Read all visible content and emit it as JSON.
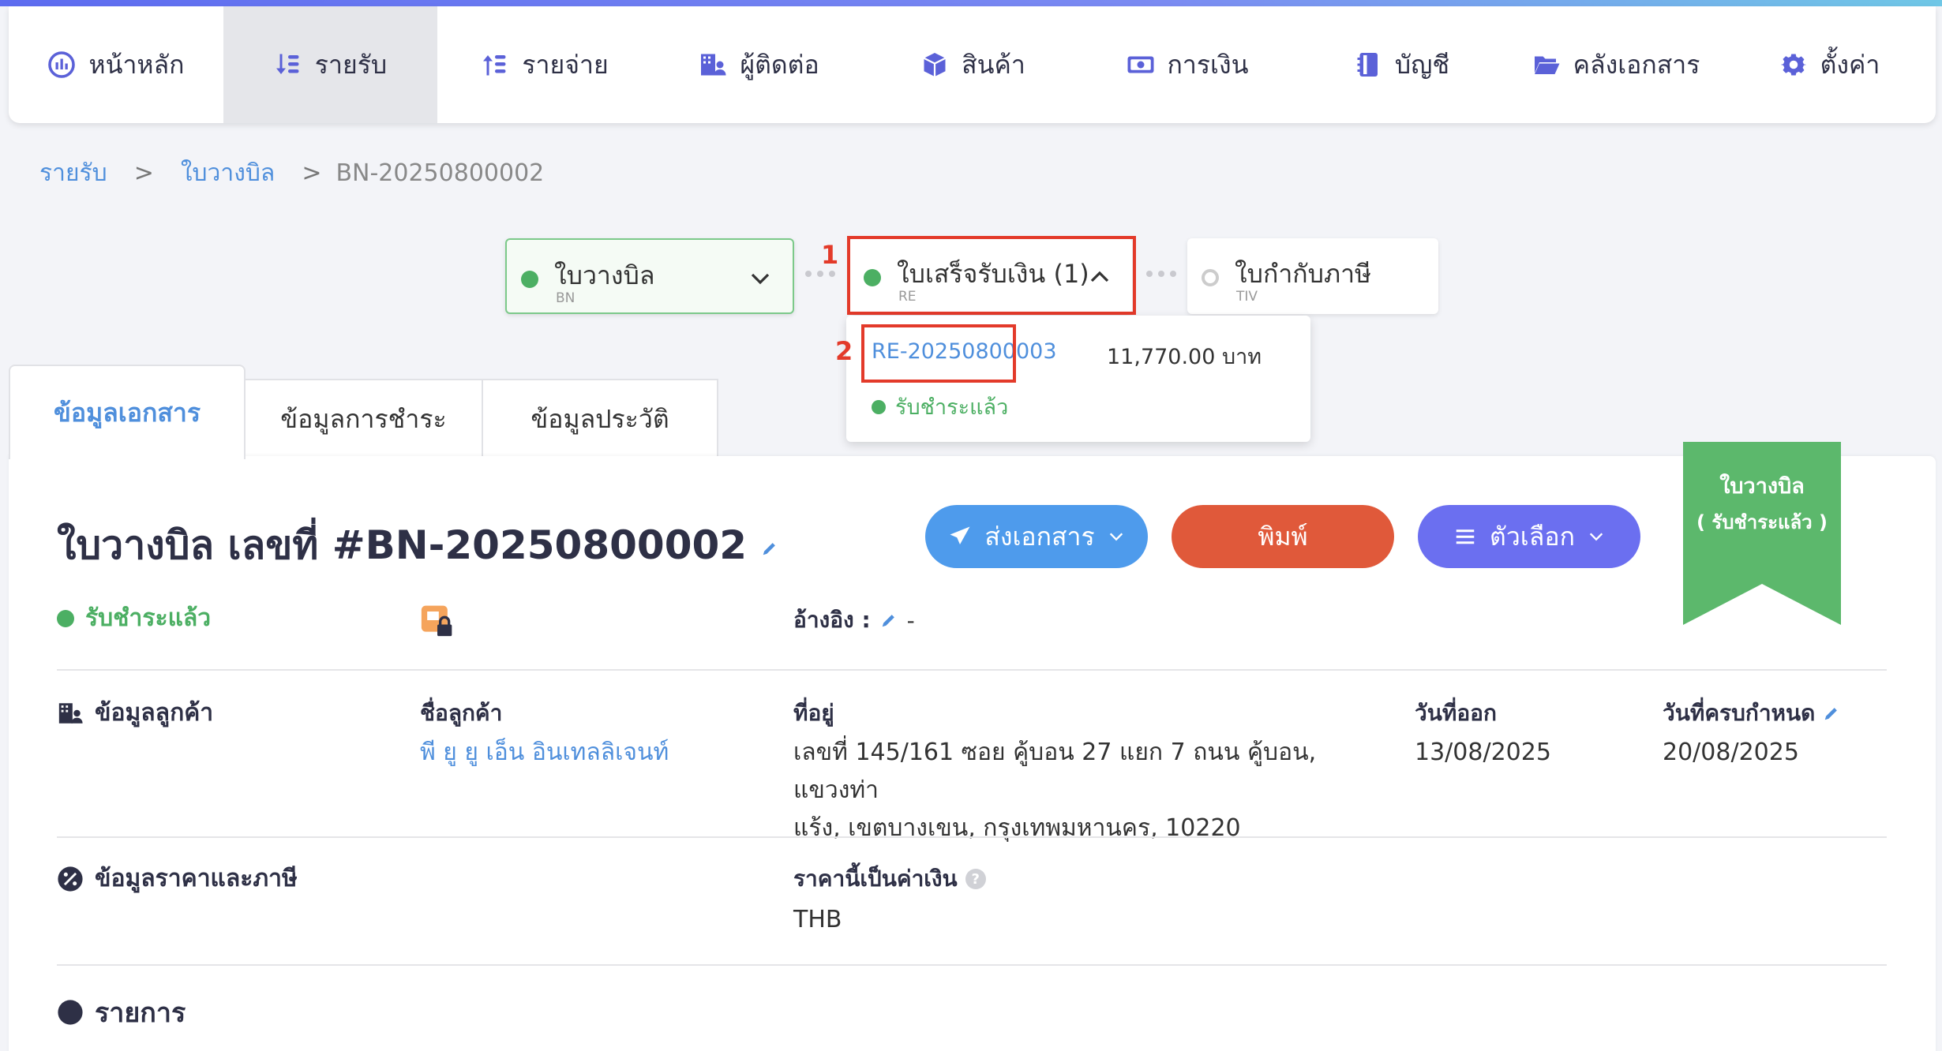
{
  "nav": {
    "items": [
      {
        "label": "หน้าหลัก",
        "icon": "dashboard-icon"
      },
      {
        "label": "รายรับ",
        "icon": "income-icon",
        "active": true
      },
      {
        "label": "รายจ่าย",
        "icon": "expense-icon"
      },
      {
        "label": "ผู้ติดต่อ",
        "icon": "contacts-icon"
      },
      {
        "label": "สินค้า",
        "icon": "product-box-icon"
      },
      {
        "label": "การเงิน",
        "icon": "money-icon"
      },
      {
        "label": "บัญชี",
        "icon": "ledger-book-icon"
      },
      {
        "label": "คลังเอกสาร",
        "icon": "folder-icon"
      },
      {
        "label": "ตั้งค่า",
        "icon": "gear-icon"
      }
    ]
  },
  "breadcrumb": {
    "level1": "รายรับ",
    "level2": "ใบวางบิล",
    "current": "BN-20250800002",
    "sep": ">"
  },
  "flow": {
    "step1": {
      "title": "ใบวางบิล",
      "sub": "BN"
    },
    "step2": {
      "title": "ใบเสร็จรับเงิน (1)",
      "sub": "RE"
    },
    "step3": {
      "title": "ใบกำกับภาษี",
      "sub": "TIV"
    },
    "annotation1": "1",
    "annotation2": "2"
  },
  "dropdown": {
    "doc_no": "RE-20250800003",
    "amount": "11,770.00 บาท",
    "status": "รับชำระแล้ว"
  },
  "tabs": [
    "ข้อมูลเอกสาร",
    "ข้อมูลการชำระ",
    "ข้อมูลประวัติ"
  ],
  "document": {
    "title": "ใบวางบิล เลขที่ #BN-20250800002",
    "status": "รับชำระแล้ว",
    "ref_label": "อ้างอิง :",
    "ref_value": "-"
  },
  "actions": {
    "send": "ส่งเอกสาร",
    "print": "พิมพ์",
    "options": "ตัวเลือก"
  },
  "ribbon": {
    "line1": "ใบวางบิล",
    "line2": "( รับชำระแล้ว )"
  },
  "customer": {
    "section_title": "ข้อมูลลูกค้า",
    "name_label": "ชื่อลูกค้า",
    "name_value": "พี ยู ยู เอ็น อินเทลลิเจนท์",
    "address_label": "ที่อยู่",
    "address_line1": "เลขที่ 145/161 ซอย คู้บอน 27 แยก 7 ถนน คู้บอน, แขวงท่า",
    "address_line2": "แร้ง, เขตบางเขน, กรุงเทพมหานคร, 10220",
    "issue_label": "วันที่ออก",
    "issue_value": "13/08/2025",
    "due_label": "วันที่ครบกำหนด",
    "due_value": "20/08/2025"
  },
  "pricing": {
    "section_title": "ข้อมูลราคาและภาษี",
    "currency_label": "ราคานี้เป็นค่าเงิน",
    "currency_value": "THB",
    "help": "?"
  },
  "items": {
    "section_title": "รายการ"
  },
  "colors": {
    "accent": "#4f8fdc",
    "green": "#4caf63",
    "send": "#4e9bec",
    "print": "#e0593a",
    "options": "#6b6ff0",
    "ribbon": "#5cb86c",
    "annotation": "#e33a2a"
  }
}
